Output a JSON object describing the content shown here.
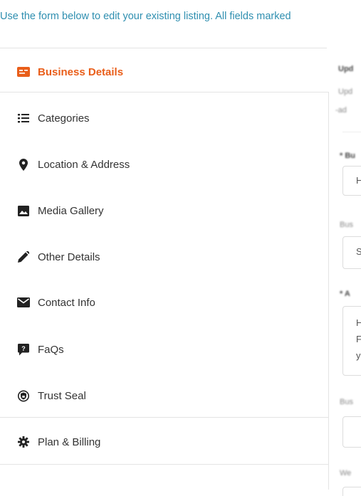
{
  "intro_text": "Use the form below to edit your existing listing. All fields marked",
  "nav": [
    {
      "label": "Business Details",
      "icon": "business-card-icon",
      "active": true
    },
    {
      "label": "Categories",
      "icon": "list-icon"
    },
    {
      "label": "Location & Address",
      "icon": "map-pin-icon"
    },
    {
      "label": "Media Gallery",
      "icon": "image-icon"
    },
    {
      "label": "Other Details",
      "icon": "pencil-icon"
    },
    {
      "label": "Contact Info",
      "icon": "envelope-icon"
    },
    {
      "label": "FaQs",
      "icon": "question-bubble-icon"
    },
    {
      "label": "Trust Seal",
      "icon": "shield-lock-icon"
    },
    {
      "label": "Plan & Billing",
      "icon": "gear-icon"
    }
  ],
  "right_column": {
    "field1_value": "H",
    "field2_value": "S",
    "textarea_lines": [
      "H",
      "F",
      "y"
    ]
  },
  "colors": {
    "accent": "#e95e1a",
    "intro": "#2f8fb0",
    "border": "#e4e4e4"
  }
}
